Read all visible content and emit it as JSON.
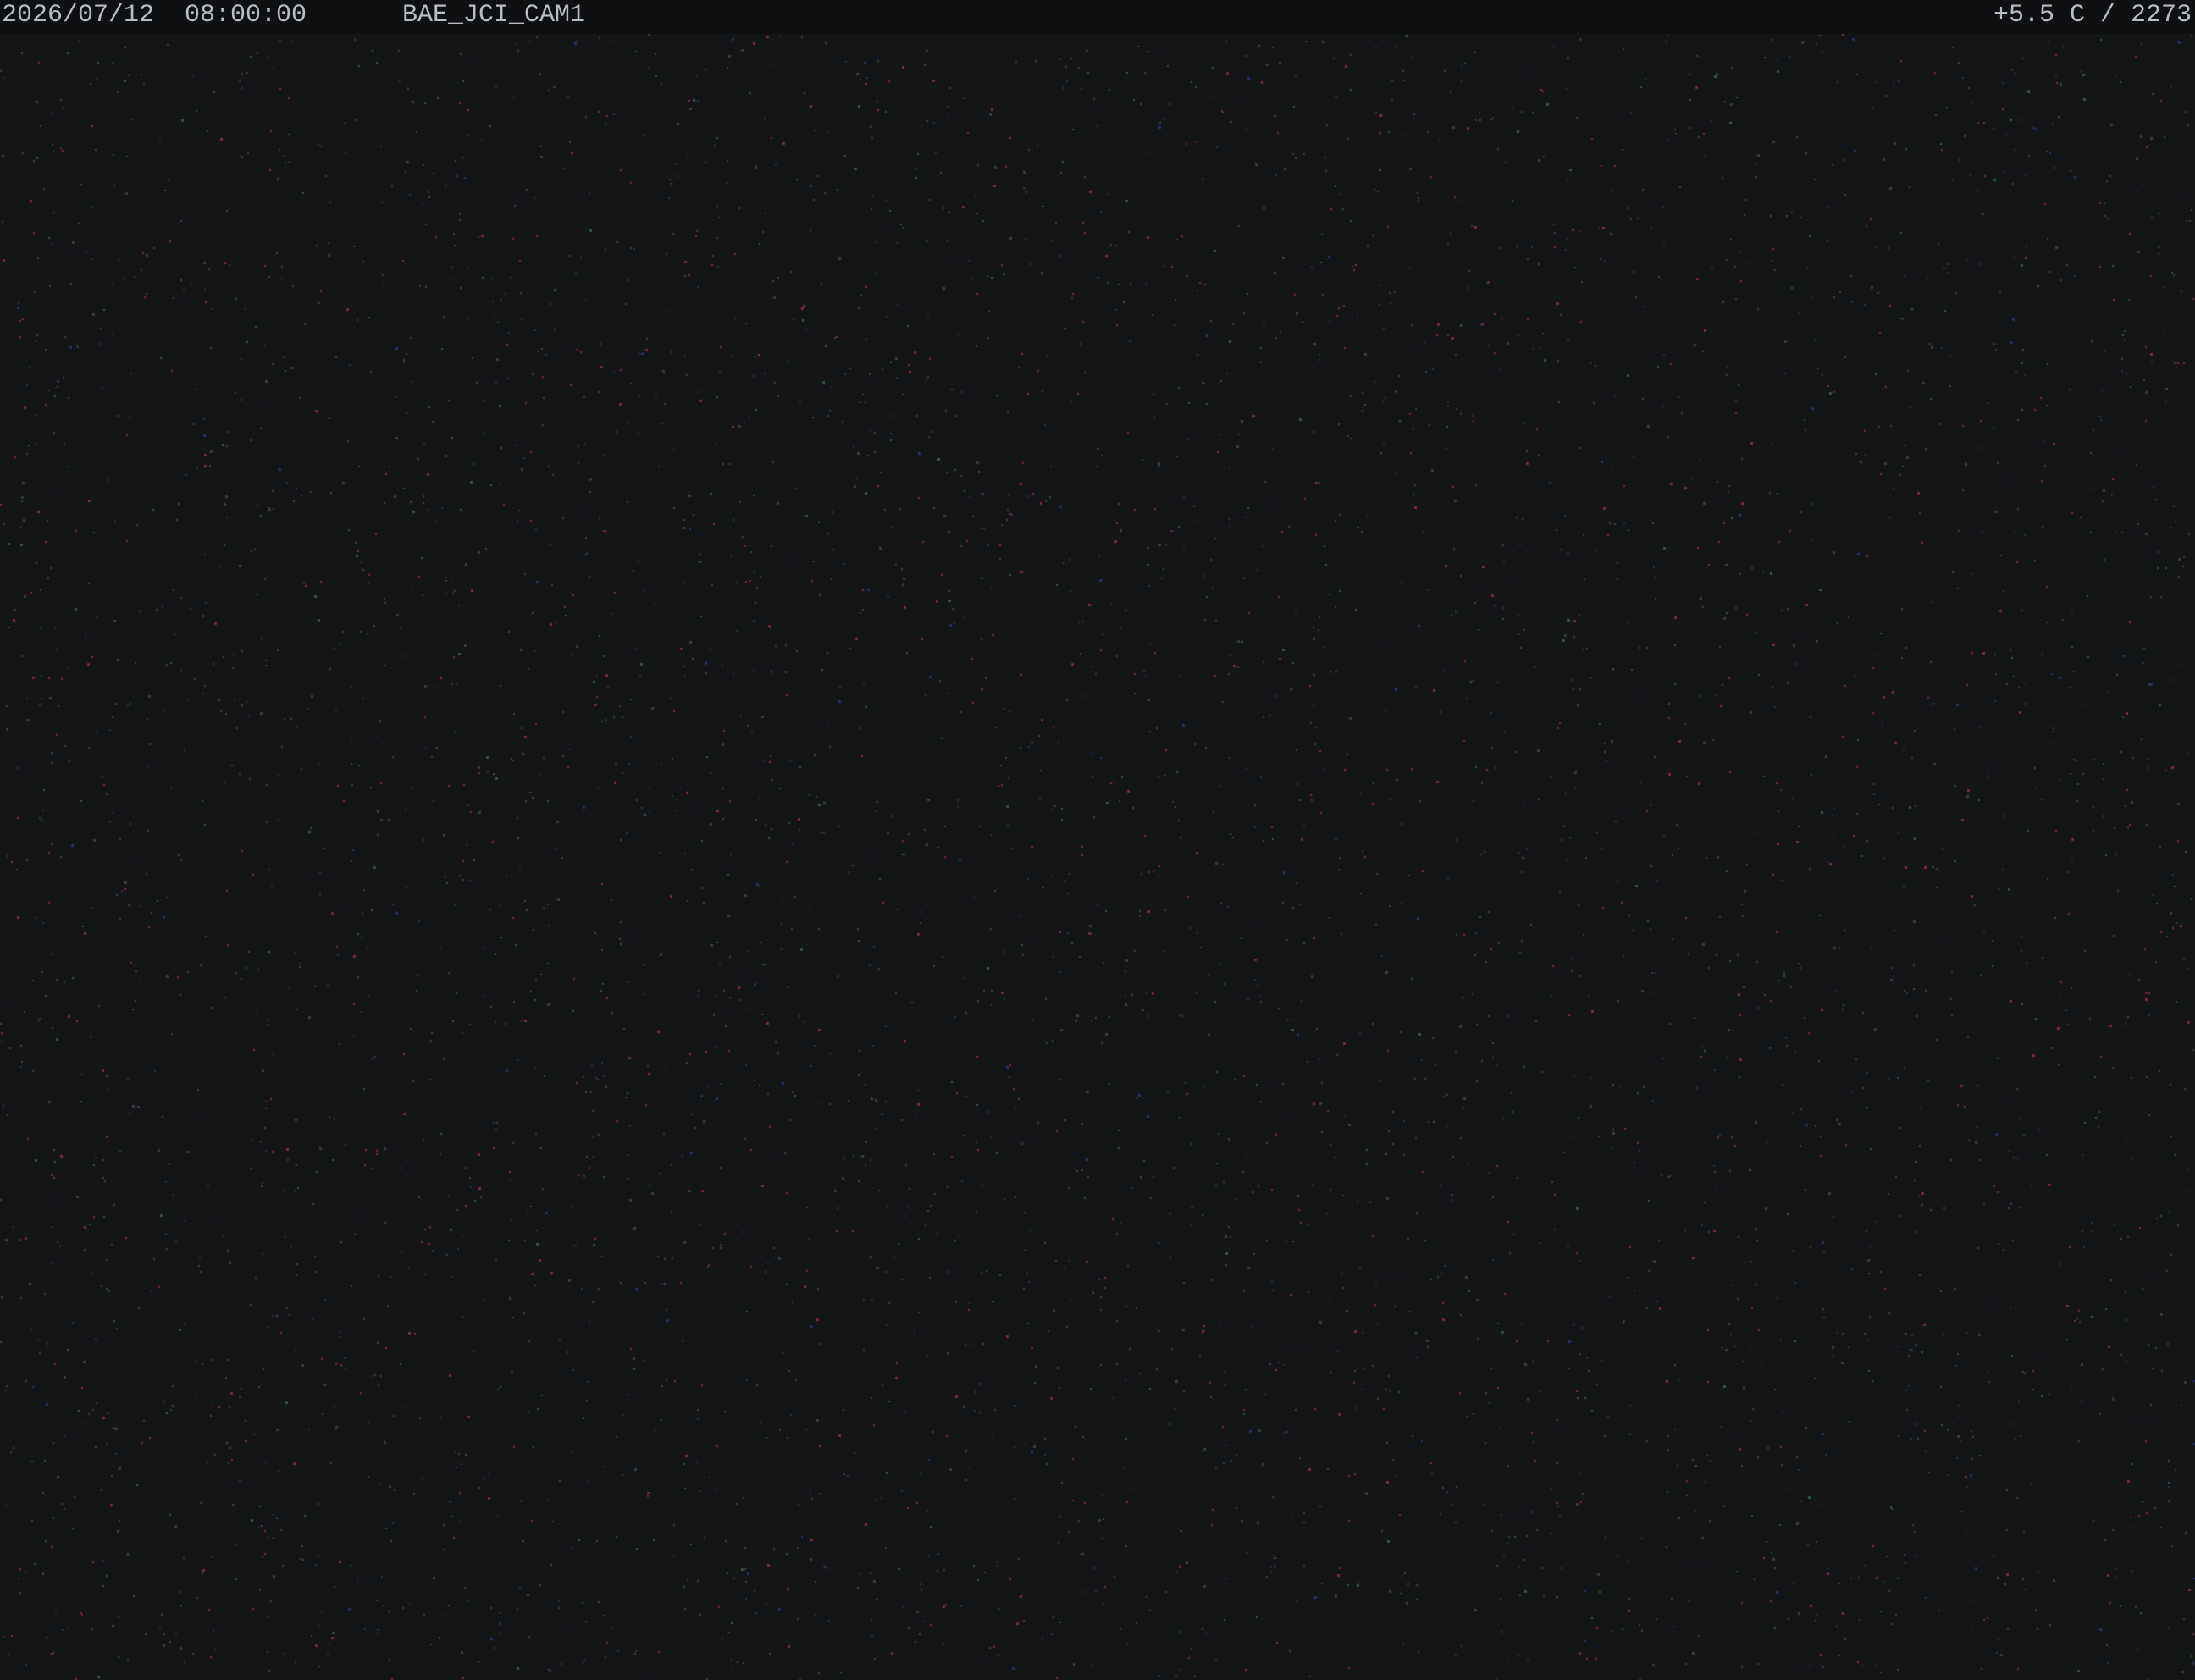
{
  "overlay": {
    "datetime": "2026/07/12  08:00:00",
    "camera_id": "BAE_JCI_CAM1",
    "telemetry": "+5.5 C / 2273"
  },
  "colors": {
    "background": "#141516",
    "overlay_bar": "#0f1011",
    "overlay_text": "#b9bcc0",
    "noise_red": "#7a2a3a",
    "noise_gray": "#3a3d40",
    "noise_blue": "#2a2f6a",
    "noise_green": "#2f5a3a"
  }
}
